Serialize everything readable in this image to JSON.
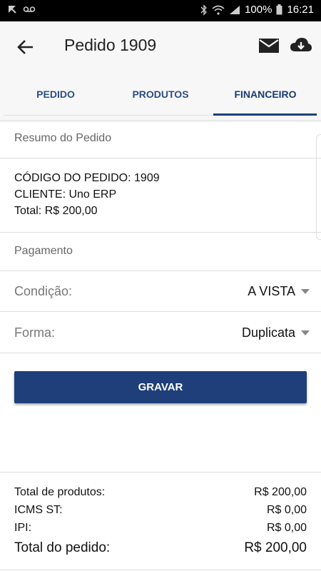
{
  "status_bar": {
    "battery": "100%",
    "time": "16:21"
  },
  "app_bar": {
    "title": "Pedido 1909"
  },
  "tabs": [
    {
      "label": "PEDIDO"
    },
    {
      "label": "PRODUTOS"
    },
    {
      "label": "FINANCEIRO"
    }
  ],
  "active_tab": "FINANCEIRO",
  "summary": {
    "section_title": "Resumo do Pedido",
    "code_line": "CÓDIGO DO PEDIDO: 1909",
    "client_line": "CLIENTE: Uno ERP",
    "total_line": "Total: R$ 200,00"
  },
  "payment": {
    "section_title": "Pagamento",
    "condition_label": "Condição:",
    "condition_value": "A VISTA",
    "form_label": "Forma:",
    "form_value": "Duplicata"
  },
  "save_button": "GRAVAR",
  "totals": {
    "products_label": "Total de produtos:",
    "products_value": "R$ 200,00",
    "icms_label": "ICMS ST:",
    "icms_value": "R$ 0,00",
    "ipi_label": "IPI:",
    "ipi_value": "R$ 0,00",
    "order_label": "Total do pedido:",
    "order_value": "R$ 200,00"
  },
  "colors": {
    "primary": "#1f3f7b",
    "tab_text": "#2c4f86"
  }
}
